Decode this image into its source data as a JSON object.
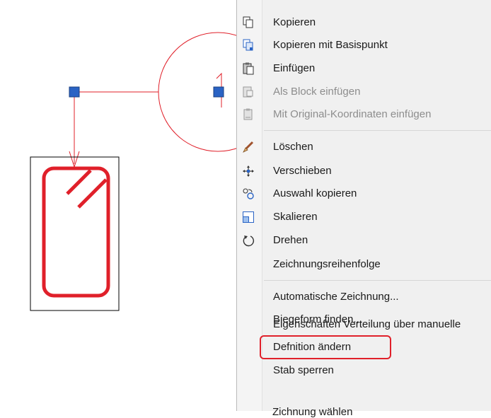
{
  "menu": {
    "items": [
      {
        "label": "Kopieren",
        "icon": "copy-icon",
        "enabled": true
      },
      {
        "label": "Kopieren mit Basispunkt",
        "icon": "copy-base-point-icon",
        "enabled": true
      },
      {
        "label": "Einfügen",
        "icon": "paste-icon",
        "enabled": true
      },
      {
        "label": "Als Block einfügen",
        "icon": "paste-as-block-icon",
        "enabled": false
      },
      {
        "label": "Mit Original-Koordinaten einfügen",
        "icon": "paste-original-coordinates-icon",
        "enabled": false
      },
      {
        "label": "Löschen",
        "icon": "erase-icon",
        "enabled": true
      },
      {
        "label": "Verschieben",
        "icon": "move-icon",
        "enabled": true
      },
      {
        "label": "Auswahl kopieren",
        "icon": "copy-selection-icon",
        "enabled": true
      },
      {
        "label": "Skalieren",
        "icon": "scale-icon",
        "enabled": true
      },
      {
        "label": "Drehen",
        "icon": "rotate-icon",
        "enabled": true
      },
      {
        "label": "Zeichnungsreihenfolge",
        "icon": "",
        "enabled": true
      },
      {
        "label": "Automatische Zeichnung...",
        "icon": "",
        "enabled": true
      },
      {
        "label": "Biegeform finden...",
        "icon": "",
        "enabled": true
      },
      {
        "label": "Eigenschaften Verteilung über manuelle",
        "icon": "",
        "enabled": true
      },
      {
        "label": "Defnition ändern",
        "icon": "",
        "enabled": true,
        "highlighted": true
      },
      {
        "label": "Stab sperren",
        "icon": "",
        "enabled": true
      }
    ],
    "clipped_label": "Zichnung wählen"
  },
  "colors": {
    "drawing_red": "#e0202a",
    "grip_blue": "#2a63c4",
    "menu_bg": "#f0f0f0"
  }
}
